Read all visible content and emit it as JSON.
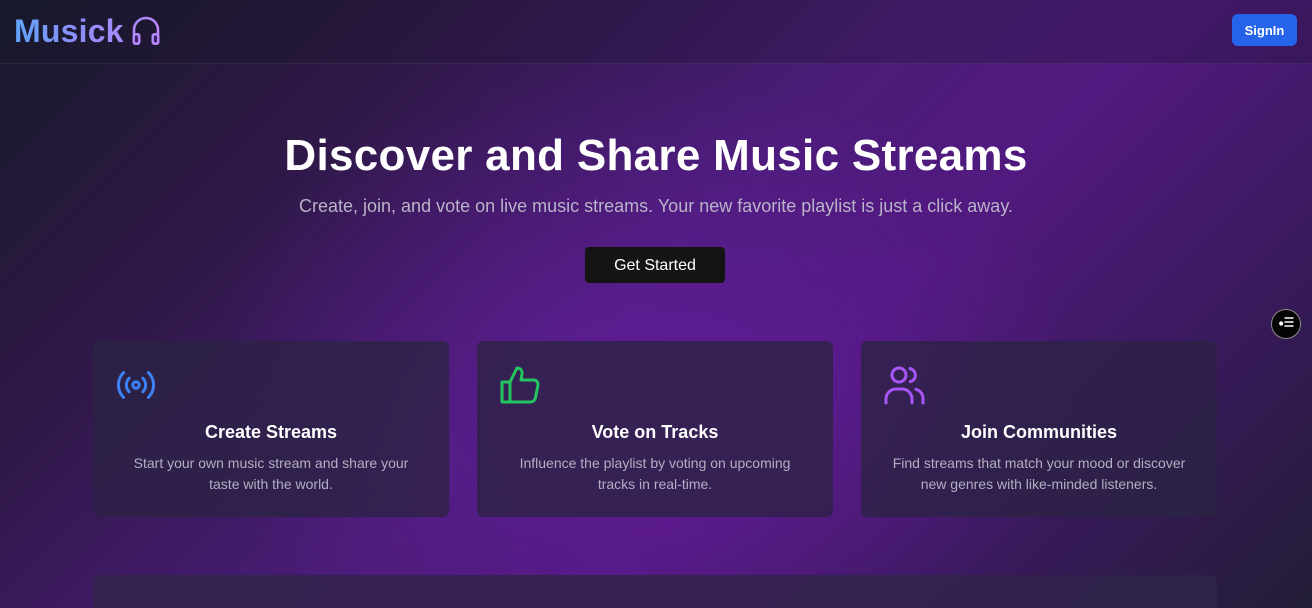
{
  "navbar": {
    "brand_name": "Musick",
    "brand_icon": "headphones-icon",
    "signin_label": "SignIn",
    "signin_color": "#2563eb"
  },
  "hero": {
    "title": "Discover and Share Music Streams",
    "subtitle": "Create, join, and vote on live music streams. Your new favorite playlist is just a click away.",
    "cta_label": "Get Started"
  },
  "features": [
    {
      "icon": "radio-broadcast-icon",
      "icon_color": "#3b82f6",
      "title": "Create Streams",
      "description": "Start your own music stream and share your taste with the world."
    },
    {
      "icon": "thumbs-up-icon",
      "icon_color": "#22c55e",
      "title": "Vote on Tracks",
      "description": "Influence the playlist by voting on upcoming tracks in real-time."
    },
    {
      "icon": "users-icon",
      "icon_color": "#a855f7",
      "title": "Join Communities",
      "description": "Find streams that match your mood or discover new genres with like-minded listeners."
    }
  ],
  "floating_widget": {
    "icon": "list-settings-icon"
  }
}
